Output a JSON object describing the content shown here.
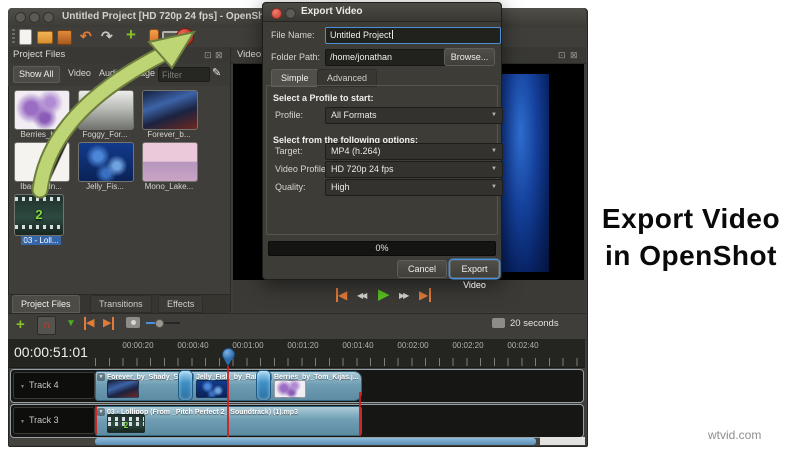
{
  "annotation": {
    "line1": "Export Video",
    "line2": "in OpenShot"
  },
  "watermark": "wtvid.com",
  "colors": {
    "accent_blue": "#4a90d9",
    "record_red": "#c4352a",
    "arrow_green": "#bdd575",
    "clip_blue": "#6f9eb4",
    "selection_blue": "#3566a8"
  },
  "icons": {
    "undock": "⊡",
    "close": "⊠",
    "chevron_down": "▼",
    "undo_arrow": "↶",
    "redo_arrow": "↷",
    "plus": "+",
    "snap_magnet": "∩",
    "marker_down": "▼",
    "arrow_left": "◀",
    "arrow_right": "▶",
    "rewind": "◀◀",
    "fast_forward": "▶▶",
    "play": "▶",
    "brush": "✎",
    "dropdown": "▼"
  },
  "window": {
    "title": "Untitled Project [HD 720p 24 fps] - OpenShot Video Editor"
  },
  "project_files": {
    "title": "Project Files",
    "filters": {
      "show_all": "Show All",
      "video": "Video",
      "audio": "Audio",
      "image": "Image"
    },
    "filter_placeholder": "Filter",
    "items": [
      {
        "label": "Berries_b..."
      },
      {
        "label": "Foggy_For..."
      },
      {
        "label": "Forever_b..."
      },
      {
        "label": "Ibanez_In..."
      },
      {
        "label": "Jelly_Fis..."
      },
      {
        "label": "Mono_Lake..."
      },
      {
        "label": "03 - Loll...",
        "selected": true,
        "art_text": "2"
      }
    ]
  },
  "preview": {
    "title": "Video Preview"
  },
  "panel_tabs": {
    "project_files": "Project Files",
    "transitions": "Transitions",
    "effects": "Effects"
  },
  "timeline": {
    "current_time": "00:00:51:01",
    "zoom_label": "20 seconds",
    "ruler_ticks": [
      "00:00:20",
      "00:00:40",
      "00:01:00",
      "00:01:20",
      "00:01:40",
      "00:02:00",
      "00:02:20",
      "00:02:40"
    ],
    "tracks": [
      {
        "name": "Track 4",
        "clips": [
          {
            "label": "Forever_by_Shady_S."
          },
          {
            "label": "Jelly_Fish_by_RaDu_G"
          },
          {
            "label": "Berries_by_Tom_Kijas.j..."
          }
        ]
      },
      {
        "name": "Track 3",
        "clips": [
          {
            "label": "03 - Lollipop (From _Pitch Perfect 2_ Soundtrack) (1).mp3",
            "art_text": "2"
          }
        ]
      }
    ]
  },
  "export_dialog": {
    "title": "Export Video",
    "file_name_label": "File Name:",
    "file_name_value": "Untitled Project",
    "folder_path_label": "Folder Path:",
    "folder_path_value": "/home/jonathan",
    "browse_label": "Browse...",
    "tabs": {
      "simple": "Simple",
      "advanced": "Advanced"
    },
    "profile_section": "Select a Profile to start:",
    "profile_label": "Profile:",
    "profile_value": "All Formats",
    "options_section": "Select from the following options:",
    "target_label": "Target:",
    "target_value": "MP4 (h.264)",
    "video_profile_label": "Video Profile:",
    "video_profile_value": "HD 720p 24 fps",
    "quality_label": "Quality:",
    "quality_value": "High",
    "progress_text": "0%",
    "cancel_label": "Cancel",
    "export_label": "Export Video"
  }
}
